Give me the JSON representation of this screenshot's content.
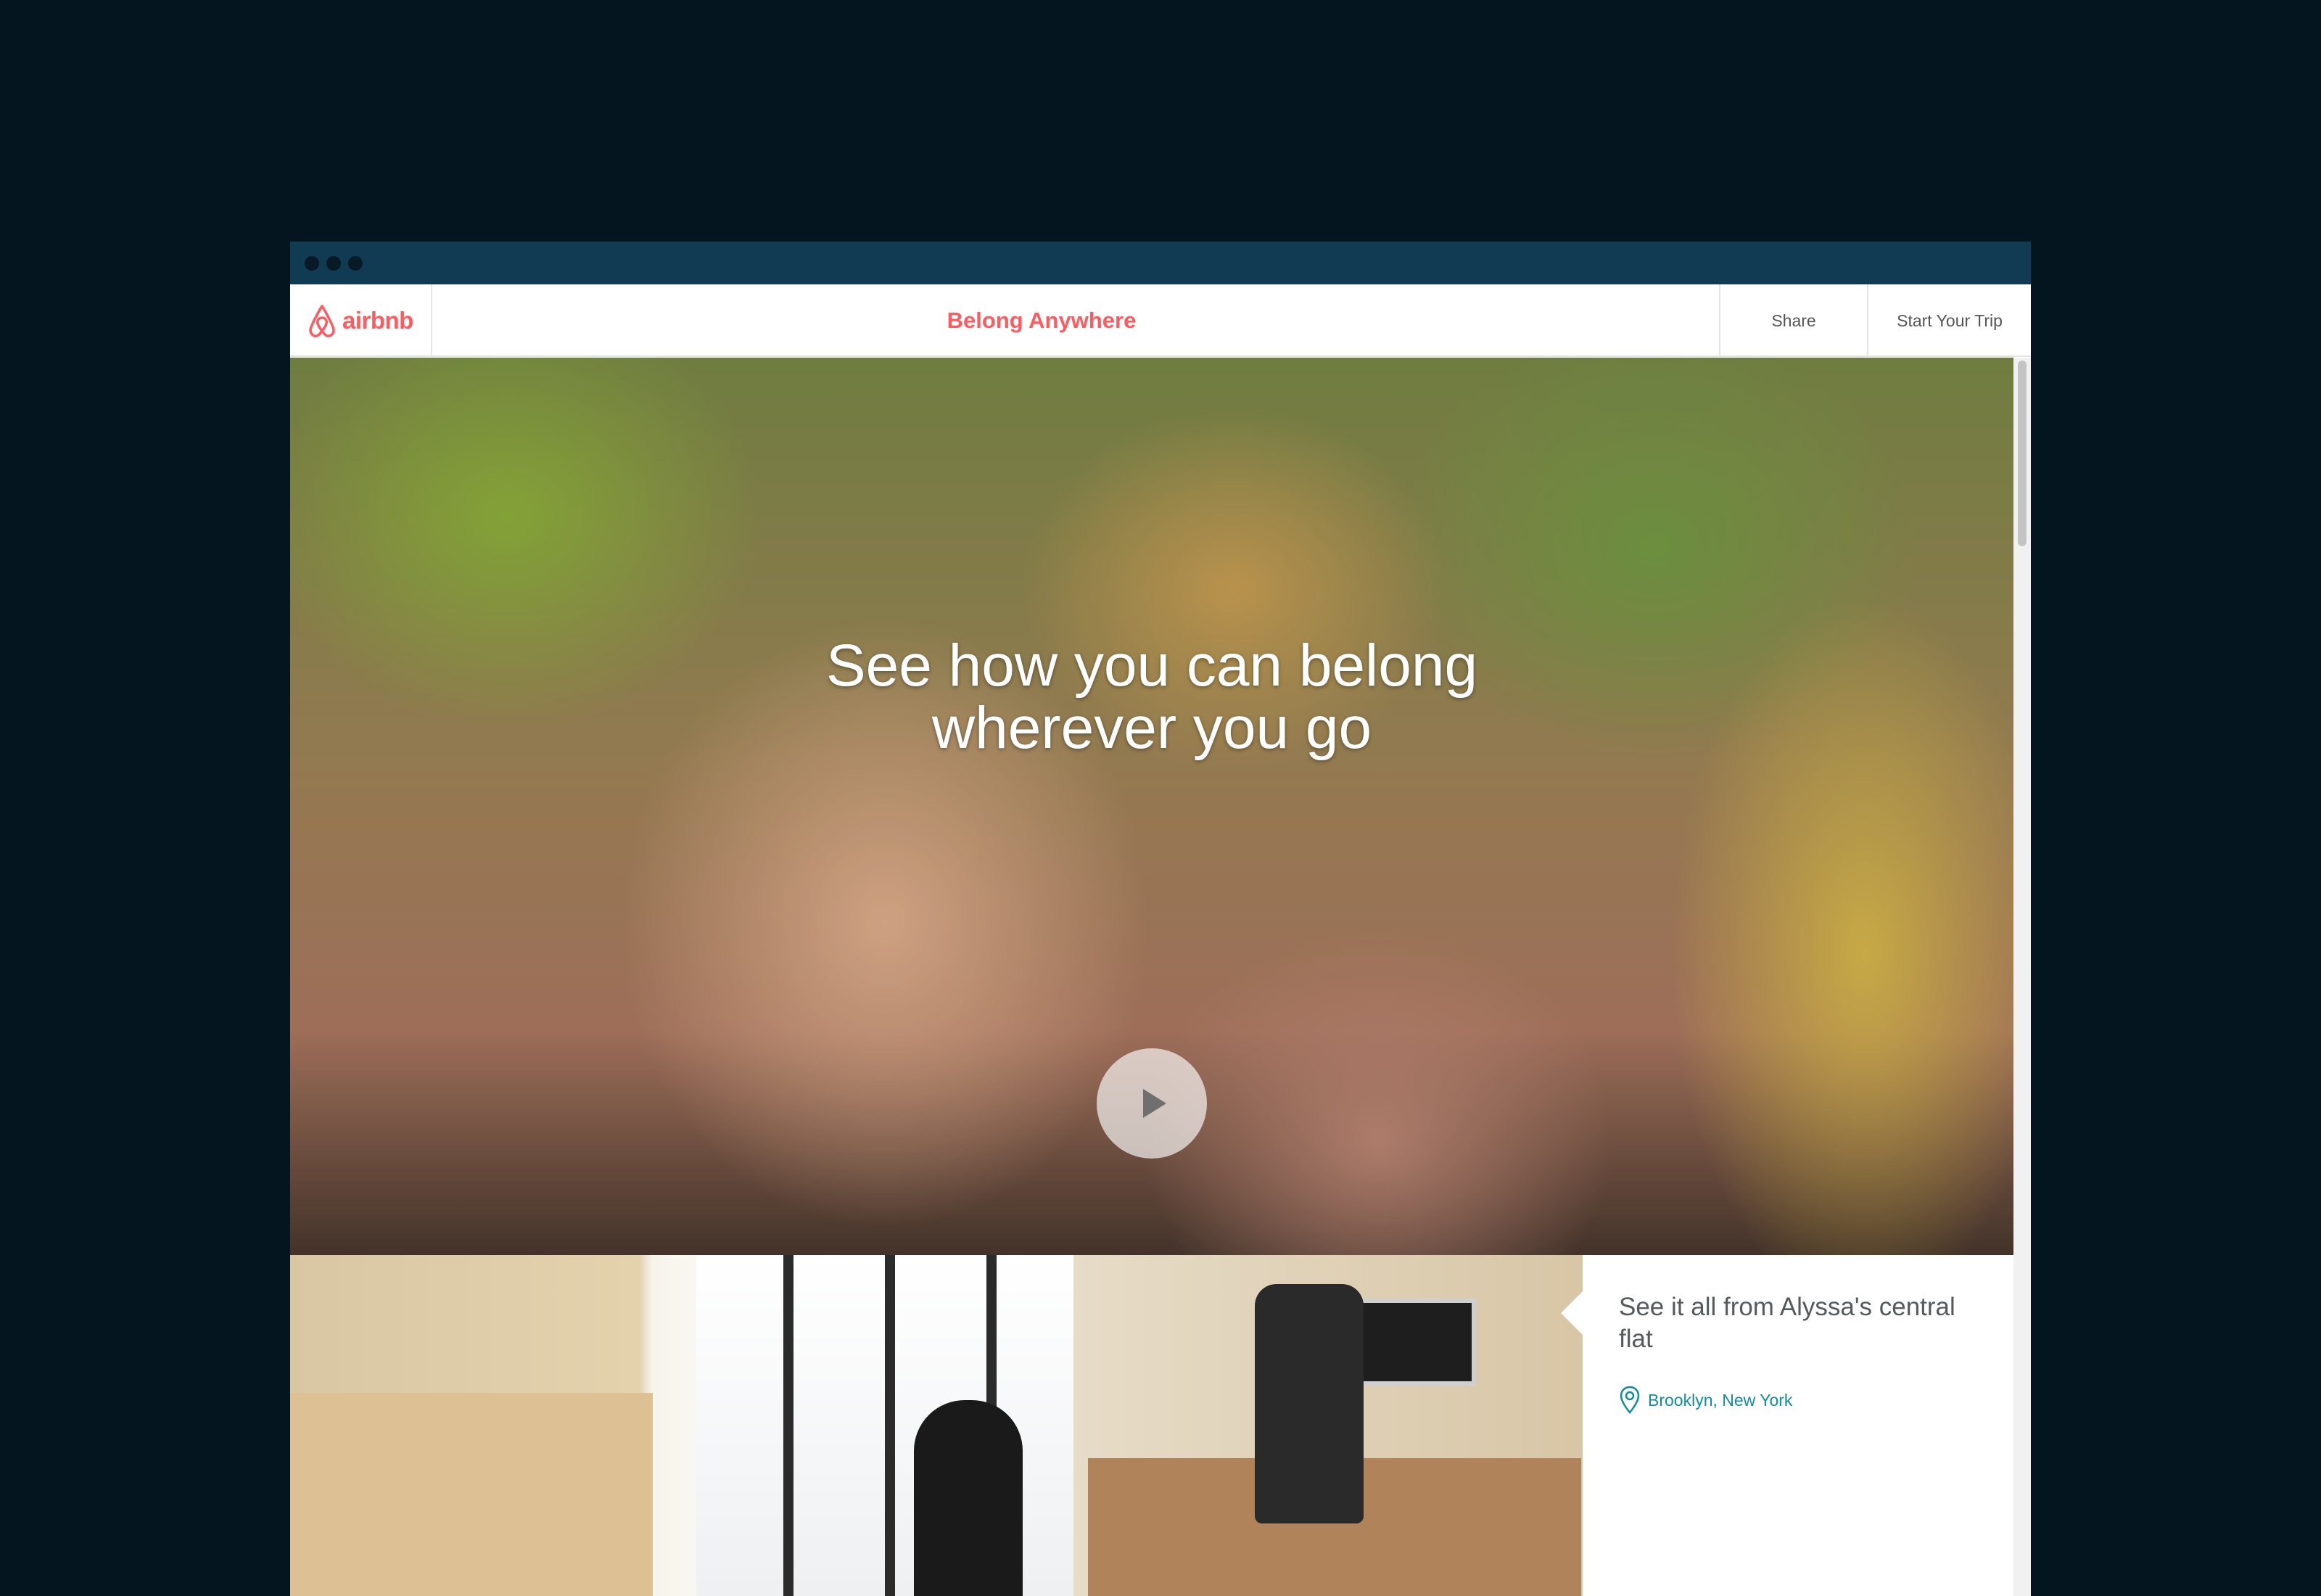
{
  "brand": {
    "name": "airbnb",
    "color": "#ff5a5f"
  },
  "navbar": {
    "title": "Belong Anywhere",
    "share_label": "Share",
    "start_trip_label": "Start Your Trip"
  },
  "hero": {
    "heading_line1": "See how you can belong",
    "heading_line2": "wherever you go",
    "play_icon": "play-icon"
  },
  "listing": {
    "title": "See it all from Alyssa's central flat",
    "location": "Brooklyn, New York",
    "location_icon": "map-pin-icon",
    "location_color": "#118c9a"
  },
  "colors": {
    "background": "#041520",
    "titlebar": "#103b52"
  }
}
